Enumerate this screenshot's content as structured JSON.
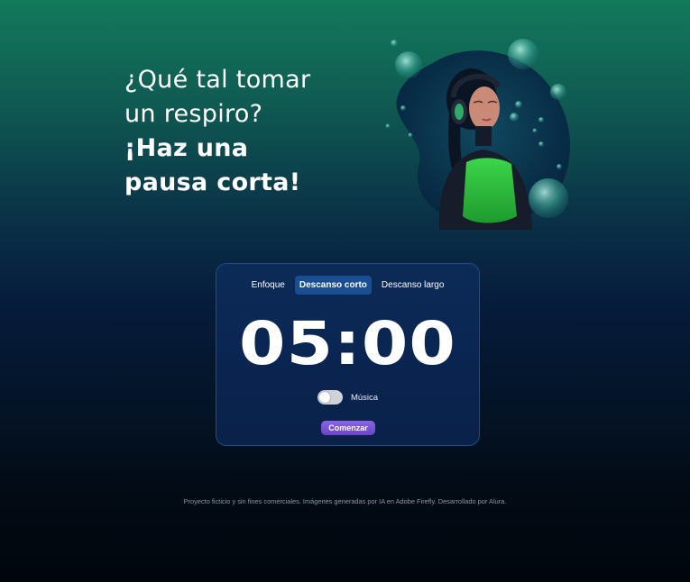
{
  "hero": {
    "line1": "¿Qué tal tomar",
    "line2": "un respiro?",
    "line3": "¡Haz una",
    "line4": "pausa corta!"
  },
  "tabs": [
    {
      "label": "Enfoque",
      "active": false
    },
    {
      "label": "Descanso corto",
      "active": true
    },
    {
      "label": "Descanso largo",
      "active": false
    }
  ],
  "timer": {
    "display": "05:00"
  },
  "music": {
    "label": "Música",
    "enabled": false
  },
  "start_button": {
    "label": "Comenzar"
  },
  "footer": {
    "text": "Proyecto ficticio y sin fines comerciales. Imágenes generadas por IA en Adobe Firefly. Desarrollado por Alura."
  },
  "colors": {
    "background_top": "#137a5b",
    "background_bottom": "#01060d",
    "card_border": "#1c4e88",
    "active_tab": "#1a4e93",
    "button": "#7b56db"
  }
}
